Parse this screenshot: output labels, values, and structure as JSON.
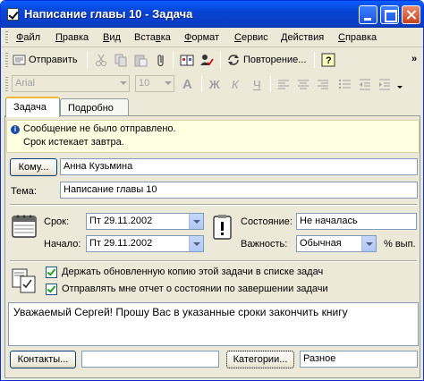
{
  "window": {
    "title": "Написание главы 10 - Задача"
  },
  "menu": [
    "Файл",
    "Правка",
    "Вид",
    "Вставка",
    "Формат",
    "Сервис",
    "Действия",
    "Справка"
  ],
  "menu_access": [
    "Ф",
    "П",
    "В",
    "в",
    "Ф",
    "С",
    "Д",
    "С"
  ],
  "toolbar": {
    "send_label": "Отправить",
    "recurrence_label": "Повторение...",
    "font_name": "Arial",
    "font_size": "10",
    "overflow_icon": "chevrons-right-icon"
  },
  "tabs": [
    "Задача",
    "Подробно"
  ],
  "info": {
    "line1": "Сообщение не было отправлено.",
    "line2": "Срок истекает завтра."
  },
  "form": {
    "to_button": "Кому...",
    "to_value": "Анна Кузьмина",
    "subject_label": "Тема:",
    "subject_value": "Написание главы 10",
    "due_label": "Срок:",
    "due_value": "Пт 29.11.2002",
    "start_label": "Начало:",
    "start_value": "Пт 29.11.2002",
    "status_label": "Состояние:",
    "status_value": "Не началась",
    "priority_label": "Важность:",
    "priority_value": "Обычная",
    "percent_label": "% вып.",
    "keep_copy_label": "Держать обновленную копию этой задачи в списке задач",
    "status_report_label": "Отправлять мне отчет о состоянии по завершении задачи",
    "keep_copy_checked": true,
    "status_report_checked": true,
    "body": "Уважаемый Сергей! Прошу Вас в указанные сроки закончить книгу",
    "contacts_button": "Контакты...",
    "contacts_value": "",
    "categories_button": "Категории...",
    "categories_value": "Разное"
  },
  "colors": {
    "title_bar": "#0844d4",
    "info_bar": "#ffffe1",
    "window_bg": "#ece9d8"
  }
}
